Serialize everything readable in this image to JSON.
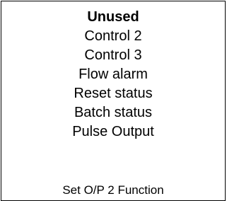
{
  "menu": {
    "options": [
      {
        "label": "Unused",
        "selected": true
      },
      {
        "label": "Control 2",
        "selected": false
      },
      {
        "label": "Control 3",
        "selected": false
      },
      {
        "label": "Flow alarm",
        "selected": false
      },
      {
        "label": "Reset status",
        "selected": false
      },
      {
        "label": "Batch status",
        "selected": false
      },
      {
        "label": "Pulse Output",
        "selected": false
      }
    ],
    "prompt": "Set O/P 2 Function"
  }
}
